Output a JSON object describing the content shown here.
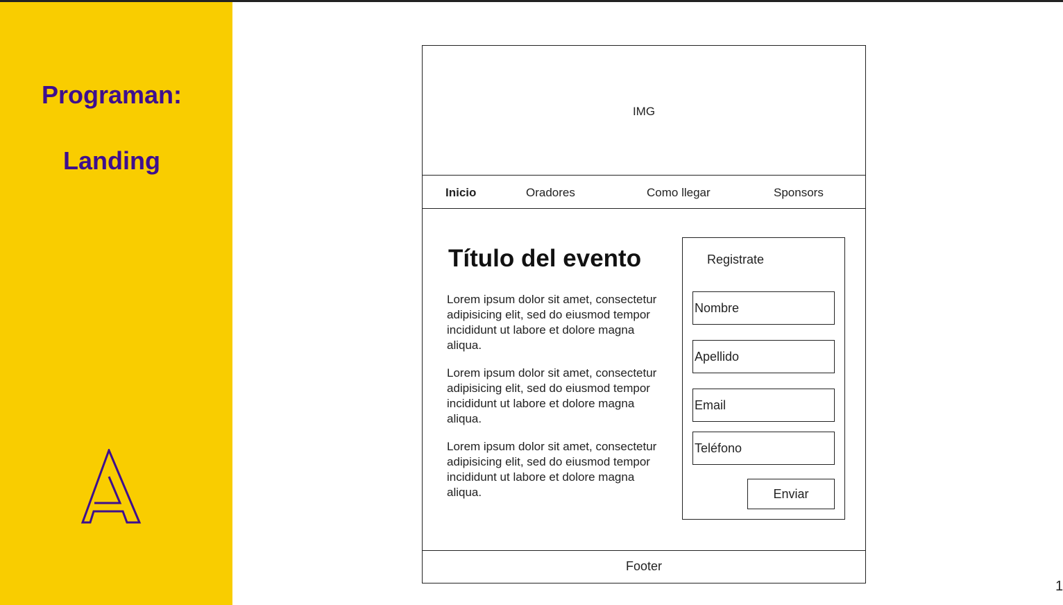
{
  "slide": {
    "title_line1": "Programan:",
    "title_line2": "Landing",
    "page_number": "1",
    "logo_icon": "a-letter-logo-icon",
    "accent_color": "#f9cd00",
    "brand_color": "#3e0f8e"
  },
  "wireframe": {
    "image_label": "IMG",
    "nav": {
      "items": [
        "Inicio",
        "Oradores",
        "Como llegar",
        "Sponsors"
      ],
      "active": "Inicio"
    },
    "event_title": "Título del evento",
    "paragraphs": [
      "Lorem ipsum dolor sit amet, consectetur adipisicing elit, sed do eiusmod tempor incididunt ut labore et dolore magna aliqua.",
      "Lorem ipsum dolor sit amet, consectetur adipisicing elit, sed do eiusmod tempor incididunt ut labore et dolore magna aliqua.",
      "Lorem ipsum dolor sit amet, consectetur adipisicing elit, sed do eiusmod tempor incididunt ut labore et dolore magna aliqua."
    ],
    "form": {
      "title": "Registrate",
      "fields": {
        "nombre": "Nombre",
        "apellido": "Apellido",
        "email": "Email",
        "telefono": "Teléfono"
      },
      "submit_label": "Enviar"
    },
    "footer": "Footer"
  }
}
